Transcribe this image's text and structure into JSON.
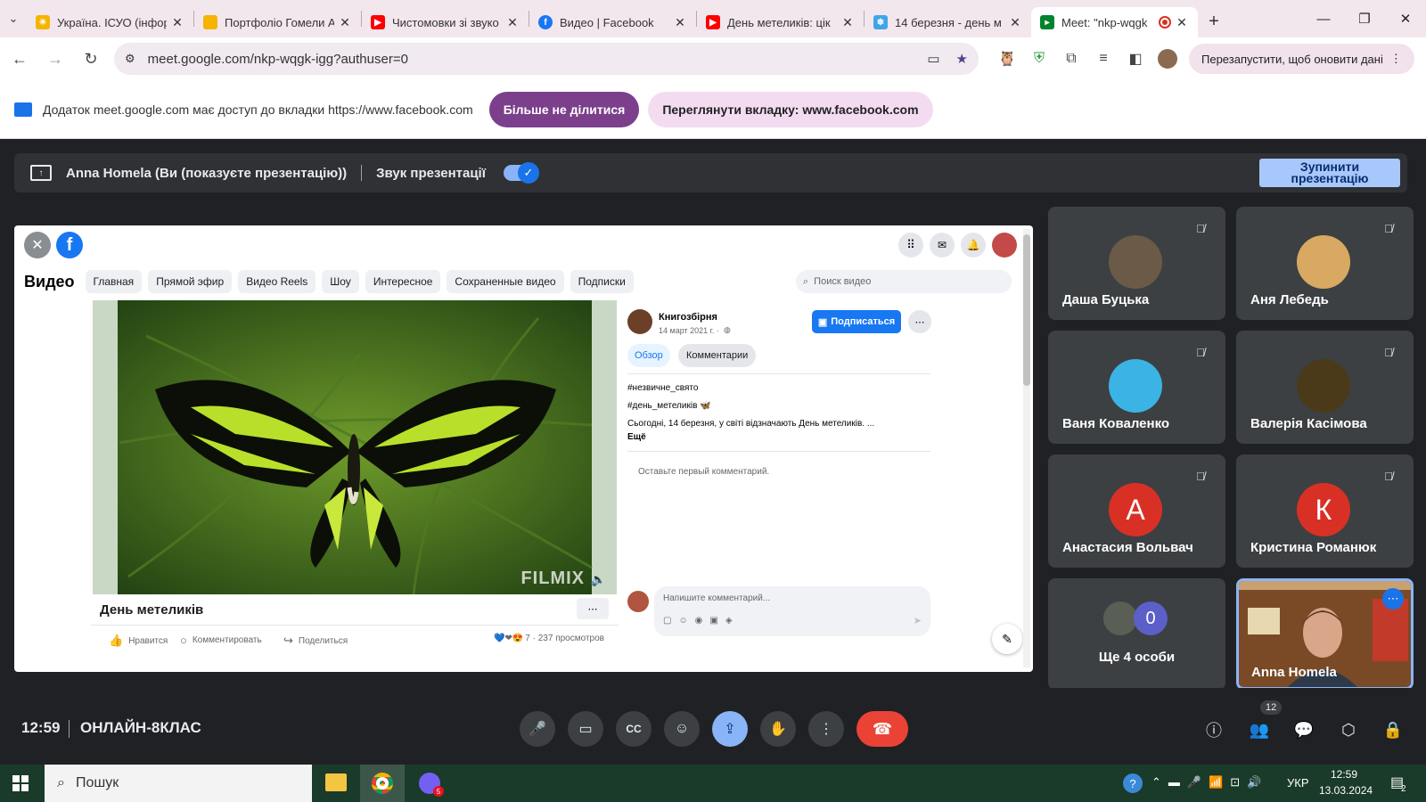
{
  "browser": {
    "tabs": [
      {
        "title": "Україна. ІСУО (інфор",
        "color": "#f6b400"
      },
      {
        "title": "Портфоліо Гомели А",
        "color": "#f4b400"
      },
      {
        "title": "Чистомовки зі звуко",
        "color": "#ff0000"
      },
      {
        "title": "Видео | Facebook",
        "color": "#1877f2"
      },
      {
        "title": "День метеликів: цік",
        "color": "#ff0000"
      },
      {
        "title": "14 березня - день м",
        "color": "#3ea6e8"
      },
      {
        "title": "Meet: \"nkp-wqgk",
        "color": "#00832d"
      }
    ],
    "url": "meet.google.com/nkp-wqgk-igg?authuser=0",
    "relaunch": "Перезапустити, щоб оновити дані",
    "new_tab": "+",
    "infobar": {
      "text": "Додаток meet.google.com має доступ до вкладки https://www.facebook.com",
      "stop_share": "Більше не ділитися",
      "view_tab": "Переглянути вкладку: www.facebook.com"
    }
  },
  "meet": {
    "presenter": "Anna Homela (Ви (показуєте презентацію))",
    "audio_label": "Звук презентації",
    "stop_presenting": "Зупинити презентацію",
    "time": "12:59",
    "meeting_name": "ОНЛАЙН-8КЛАС",
    "participants_count": "12",
    "participants": [
      {
        "name": "Даша Буцька",
        "avatar": "photo",
        "color": "#6b5a48"
      },
      {
        "name": "Аня Лебедь",
        "avatar": "photo",
        "color": "#d9a862"
      },
      {
        "name": "Ваня Коваленко",
        "avatar": "photo",
        "color": "#3bb3e4"
      },
      {
        "name": "Валерія Касімова",
        "avatar": "photo",
        "color": "#4a3a1a"
      },
      {
        "name": "Анастасия Вольвач",
        "avatar": "А",
        "color": "#d93025"
      },
      {
        "name": "Кристина Романюк",
        "avatar": "К",
        "color": "#d93025"
      }
    ],
    "others": {
      "label": "Ще 4 особи",
      "count": "0"
    },
    "self": {
      "name": "Anna Homela"
    }
  },
  "facebook": {
    "section": "Видео",
    "nav": [
      "Главная",
      "Прямой эфир",
      "Видео Reels",
      "Шоу",
      "Интересное",
      "Сохраненные видео",
      "Подписки"
    ],
    "search_placeholder": "Поиск видео",
    "page_name": "Книгозбірня",
    "post_date": "14 март 2021 г. ·",
    "subscribe": "Подписаться",
    "tab_overview": "Обзор",
    "tab_comments": "Комментарии",
    "hashtag1": "#незвичне_свято",
    "hashtag2": "#день_метеликів 🦋",
    "description": "Сьогодні, 14 березня, у світі відзначають День метеликів. ...",
    "more": "Ещё",
    "first_comment": "Оставьте первый комментарий.",
    "comment_placeholder": "Напишите комментарий...",
    "video_title": "День метеликів",
    "watermark": "FILMIX",
    "like": "Нравится",
    "comment": "Комментировать",
    "share": "Поделиться",
    "reactions": "7 · 237 просмотров"
  },
  "taskbar": {
    "search": "Пошук",
    "lang": "УКР",
    "time": "12:59",
    "date": "13.03.2024",
    "badge": "2"
  }
}
